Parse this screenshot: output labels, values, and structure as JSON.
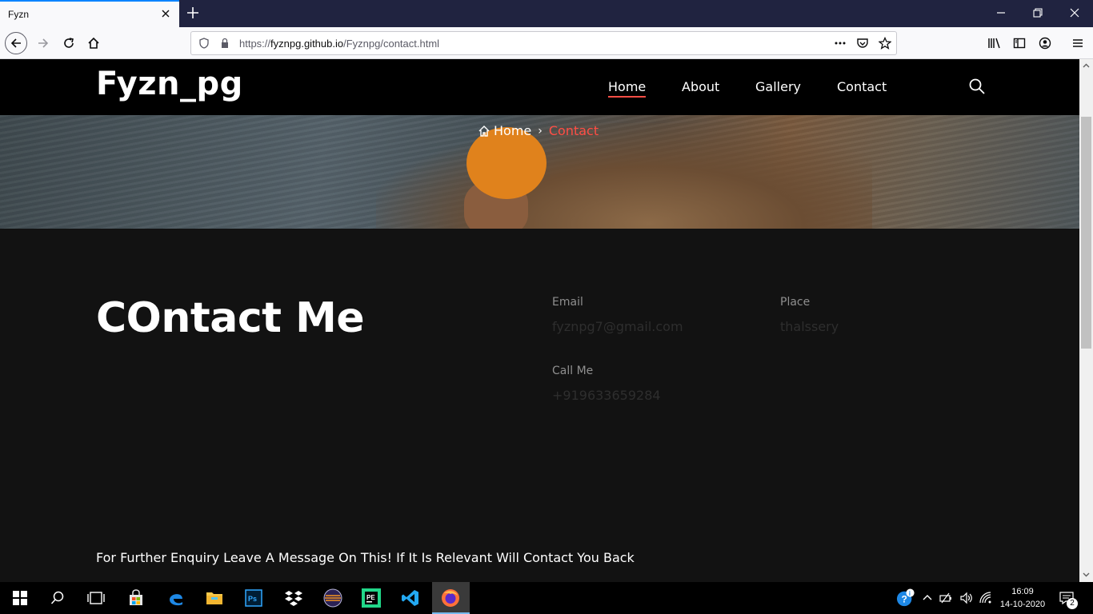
{
  "browser": {
    "tab_title": "Fyzn",
    "url_prefix": "https://",
    "url_host": "fyznpg.github.io",
    "url_path": "/Fyznpg/contact.html"
  },
  "site": {
    "logo": "Fyzn_pg",
    "nav": [
      "Home",
      "About",
      "Gallery",
      "Contact"
    ],
    "active_nav": "Home"
  },
  "hero": {
    "breadcrumb_home": "Home",
    "breadcrumb_current": "Contact"
  },
  "contact": {
    "title": "COntact Me",
    "email_label": "Email",
    "email_value": "fyznpg7@gmail.com",
    "place_label": "Place",
    "place_value": "thalssery",
    "call_label": "Call Me",
    "call_value": "+919633659284",
    "enquiry_text": "For Further Enquiry Leave A Message On This! If It Is Relevant Will Contact You Back"
  },
  "taskbar": {
    "time": "16:09",
    "date": "14-10-2020",
    "notification_count": "2"
  },
  "colors": {
    "accent": "#ff4e45",
    "header_bg": "#000000",
    "content_bg": "#121212",
    "tab_strip": "#202340"
  }
}
